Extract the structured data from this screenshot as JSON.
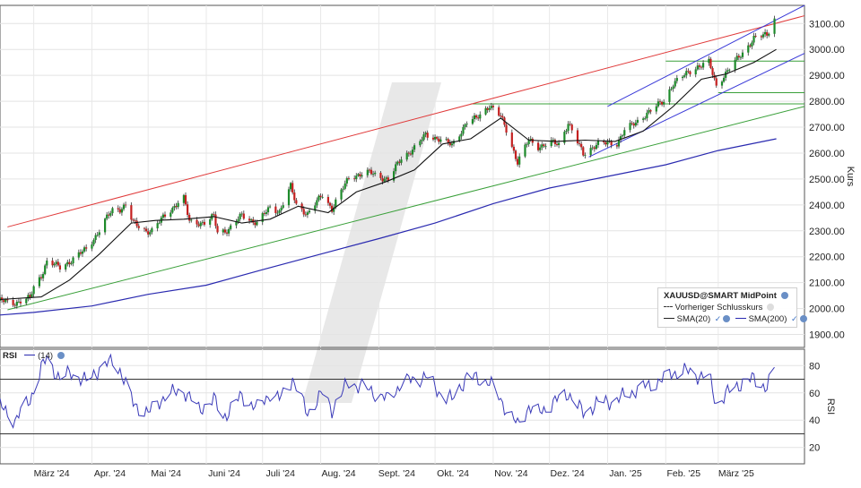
{
  "chart_data": [
    {
      "type": "candlestick",
      "symbol": "XAUUSD@SMART MidPoint",
      "ylabel": "Kurs",
      "ylim": [
        1850,
        3170
      ],
      "y_ticks": [
        "1900.00",
        "2000.00",
        "2100.00",
        "2200.00",
        "2300.00",
        "2400.00",
        "2500.00",
        "2600.00",
        "2700.00",
        "2800.00",
        "2900.00",
        "3000.00",
        "3100.00"
      ],
      "x_labels": [
        "März '24",
        "Apr. '24",
        "Mai '24",
        "Juni '24",
        "Juli '24",
        "Aug. '24",
        "Sept. '24",
        "Okt. '24",
        "Nov. '24",
        "Dez. '24",
        "Jan. '25",
        "Feb. '25",
        "März '25"
      ],
      "x_label_dates": [
        "2024-03-01",
        "2024-04-01",
        "2024-05-01",
        "2024-06-01",
        "2024-07-01",
        "2024-08-01",
        "2024-09-01",
        "2024-10-01",
        "2024-11-01",
        "2024-12-01",
        "2025-01-01",
        "2025-02-01",
        "2025-03-01"
      ],
      "x_start": "2024-02-12",
      "x_end": "2025-04-16",
      "close_points": [
        [
          "2024-02-12",
          2030
        ],
        [
          "2024-02-20",
          2022
        ],
        [
          "2024-02-28",
          2040
        ],
        [
          "2024-03-01",
          2083
        ],
        [
          "2024-03-05",
          2128
        ],
        [
          "2024-03-08",
          2180
        ],
        [
          "2024-03-15",
          2160
        ],
        [
          "2024-03-21",
          2185
        ],
        [
          "2024-03-29",
          2230
        ],
        [
          "2024-04-04",
          2290
        ],
        [
          "2024-04-09",
          2350
        ],
        [
          "2024-04-12",
          2380
        ],
        [
          "2024-04-16",
          2385
        ],
        [
          "2024-04-19",
          2400
        ],
        [
          "2024-04-23",
          2330
        ],
        [
          "2024-04-30",
          2300
        ],
        [
          "2024-05-03",
          2300
        ],
        [
          "2024-05-10",
          2360
        ],
        [
          "2024-05-17",
          2410
        ],
        [
          "2024-05-20",
          2425
        ],
        [
          "2024-05-23",
          2335
        ],
        [
          "2024-05-31",
          2330
        ],
        [
          "2024-06-05",
          2355
        ],
        [
          "2024-06-07",
          2295
        ],
        [
          "2024-06-13",
          2305
        ],
        [
          "2024-06-20",
          2360
        ],
        [
          "2024-06-28",
          2330
        ],
        [
          "2024-07-05",
          2390
        ],
        [
          "2024-07-10",
          2375
        ],
        [
          "2024-07-16",
          2470
        ],
        [
          "2024-07-19",
          2400
        ],
        [
          "2024-07-25",
          2365
        ],
        [
          "2024-08-02",
          2440
        ],
        [
          "2024-08-07",
          2385
        ],
        [
          "2024-08-16",
          2505
        ],
        [
          "2024-08-20",
          2515
        ],
        [
          "2024-08-27",
          2525
        ],
        [
          "2024-09-06",
          2497
        ],
        [
          "2024-09-13",
          2580
        ],
        [
          "2024-09-20",
          2620
        ],
        [
          "2024-09-26",
          2670
        ],
        [
          "2024-10-02",
          2658
        ],
        [
          "2024-10-10",
          2630
        ],
        [
          "2024-10-18",
          2720
        ],
        [
          "2024-10-23",
          2733
        ],
        [
          "2024-10-30",
          2785
        ],
        [
          "2024-11-05",
          2740
        ],
        [
          "2024-11-08",
          2690
        ],
        [
          "2024-11-14",
          2565
        ],
        [
          "2024-11-20",
          2650
        ],
        [
          "2024-11-25",
          2625
        ],
        [
          "2024-12-02",
          2640
        ],
        [
          "2024-12-06",
          2633
        ],
        [
          "2024-12-11",
          2718
        ],
        [
          "2024-12-19",
          2595
        ],
        [
          "2024-12-26",
          2635
        ],
        [
          "2025-01-06",
          2638
        ],
        [
          "2025-01-10",
          2690
        ],
        [
          "2025-01-16",
          2715
        ],
        [
          "2025-01-22",
          2755
        ],
        [
          "2025-01-31",
          2800
        ],
        [
          "2025-02-05",
          2870
        ],
        [
          "2025-02-11",
          2900
        ],
        [
          "2025-02-18",
          2935
        ],
        [
          "2025-02-24",
          2950
        ],
        [
          "2025-02-28",
          2858
        ],
        [
          "2025-03-06",
          2920
        ],
        [
          "2025-03-14",
          2985
        ],
        [
          "2025-03-20",
          3045
        ],
        [
          "2025-03-27",
          3055
        ],
        [
          "2025-03-31",
          3120
        ]
      ],
      "sma20_points": [
        [
          "2024-02-12",
          2035
        ],
        [
          "2024-03-05",
          2045
        ],
        [
          "2024-03-20",
          2110
        ],
        [
          "2024-04-05",
          2210
        ],
        [
          "2024-04-22",
          2330
        ],
        [
          "2024-05-05",
          2340
        ],
        [
          "2024-05-20",
          2345
        ],
        [
          "2024-06-05",
          2355
        ],
        [
          "2024-06-20",
          2330
        ],
        [
          "2024-07-05",
          2345
        ],
        [
          "2024-07-20",
          2395
        ],
        [
          "2024-08-05",
          2370
        ],
        [
          "2024-08-20",
          2450
        ],
        [
          "2024-09-05",
          2490
        ],
        [
          "2024-09-20",
          2535
        ],
        [
          "2024-10-05",
          2635
        ],
        [
          "2024-10-20",
          2655
        ],
        [
          "2024-11-05",
          2735
        ],
        [
          "2024-11-20",
          2650
        ],
        [
          "2024-12-05",
          2645
        ],
        [
          "2024-12-20",
          2650
        ],
        [
          "2025-01-05",
          2645
        ],
        [
          "2025-01-20",
          2685
        ],
        [
          "2025-02-05",
          2780
        ],
        [
          "2025-02-20",
          2885
        ],
        [
          "2025-03-05",
          2905
        ],
        [
          "2025-03-20",
          2950
        ],
        [
          "2025-04-01",
          3000
        ]
      ],
      "sma200_points": [
        [
          "2024-02-12",
          1975
        ],
        [
          "2024-03-01",
          1985
        ],
        [
          "2024-04-01",
          2010
        ],
        [
          "2024-05-01",
          2055
        ],
        [
          "2024-06-01",
          2090
        ],
        [
          "2024-07-01",
          2150
        ],
        [
          "2024-08-01",
          2210
        ],
        [
          "2024-09-01",
          2270
        ],
        [
          "2024-10-01",
          2330
        ],
        [
          "2024-11-01",
          2405
        ],
        [
          "2024-12-01",
          2465
        ],
        [
          "2025-01-01",
          2510
        ],
        [
          "2025-02-01",
          2555
        ],
        [
          "2025-03-01",
          2610
        ],
        [
          "2025-04-01",
          2655
        ]
      ],
      "trendlines": [
        {
          "color": "#e03a3a",
          "from": [
            "2024-02-16",
            2315
          ],
          "to": [
            "2025-04-16",
            3130
          ]
        },
        {
          "color": "#3aa03a",
          "from": [
            "2024-02-16",
            1995
          ],
          "to": [
            "2025-04-16",
            2780
          ]
        },
        {
          "color": "#3a3ad8",
          "from": [
            "2025-01-01",
            2780
          ],
          "to": [
            "2025-04-16",
            3170
          ]
        },
        {
          "color": "#3a3ad8",
          "from": [
            "2024-12-22",
            2585
          ],
          "to": [
            "2025-04-16",
            2985
          ]
        }
      ],
      "support_levels": [
        {
          "value": 2790,
          "from": "2024-10-20",
          "to": "2025-04-16"
        },
        {
          "value": 2833,
          "from": "2025-03-01",
          "to": "2025-04-16"
        },
        {
          "value": 2955,
          "from": "2025-02-01",
          "to": "2025-04-16"
        }
      ],
      "legend": {
        "title": "XAUUSD@SMART MidPoint",
        "prev_close": "Vorheriger Schlusskurs",
        "sma20": "SMA(20)",
        "sma200": "SMA(200)"
      }
    },
    {
      "type": "line",
      "name": "RSI",
      "period_label": "(14)",
      "ylabel": "RSI",
      "ylim": [
        8,
        92
      ],
      "y_ticks": [
        "20",
        "40",
        "60",
        "80"
      ],
      "levels": [
        70,
        30
      ],
      "rsi_points": [
        [
          "2024-02-12",
          50
        ],
        [
          "2024-02-20",
          40
        ],
        [
          "2024-02-28",
          55
        ],
        [
          "2024-03-05",
          78
        ],
        [
          "2024-03-08",
          85
        ],
        [
          "2024-03-15",
          70
        ],
        [
          "2024-03-21",
          75
        ],
        [
          "2024-03-29",
          68
        ],
        [
          "2024-04-05",
          78
        ],
        [
          "2024-04-12",
          83
        ],
        [
          "2024-04-16",
          77
        ],
        [
          "2024-04-23",
          52
        ],
        [
          "2024-05-01",
          45
        ],
        [
          "2024-05-10",
          58
        ],
        [
          "2024-05-20",
          62
        ],
        [
          "2024-05-28",
          48
        ],
        [
          "2024-06-05",
          55
        ],
        [
          "2024-06-10",
          42
        ],
        [
          "2024-06-20",
          58
        ],
        [
          "2024-06-28",
          48
        ],
        [
          "2024-07-05",
          60
        ],
        [
          "2024-07-10",
          55
        ],
        [
          "2024-07-17",
          70
        ],
        [
          "2024-07-25",
          45
        ],
        [
          "2024-08-02",
          60
        ],
        [
          "2024-08-07",
          48
        ],
        [
          "2024-08-16",
          68
        ],
        [
          "2024-08-27",
          62
        ],
        [
          "2024-09-06",
          55
        ],
        [
          "2024-09-13",
          67
        ],
        [
          "2024-09-20",
          70
        ],
        [
          "2024-09-26",
          72
        ],
        [
          "2024-10-05",
          58
        ],
        [
          "2024-10-10",
          55
        ],
        [
          "2024-10-18",
          72
        ],
        [
          "2024-10-30",
          68
        ],
        [
          "2024-11-05",
          55
        ],
        [
          "2024-11-08",
          48
        ],
        [
          "2024-11-14",
          36
        ],
        [
          "2024-11-20",
          50
        ],
        [
          "2024-11-25",
          45
        ],
        [
          "2024-12-02",
          52
        ],
        [
          "2024-12-11",
          60
        ],
        [
          "2024-12-19",
          45
        ],
        [
          "2024-12-26",
          52
        ],
        [
          "2025-01-06",
          55
        ],
        [
          "2025-01-16",
          62
        ],
        [
          "2025-01-22",
          65
        ],
        [
          "2025-01-31",
          70
        ],
        [
          "2025-02-05",
          75
        ],
        [
          "2025-02-11",
          76
        ],
        [
          "2025-02-18",
          73
        ],
        [
          "2025-02-24",
          72
        ],
        [
          "2025-02-28",
          52
        ],
        [
          "2025-03-06",
          60
        ],
        [
          "2025-03-14",
          68
        ],
        [
          "2025-03-20",
          70
        ],
        [
          "2025-03-27",
          64
        ],
        [
          "2025-03-31",
          76
        ]
      ]
    }
  ]
}
